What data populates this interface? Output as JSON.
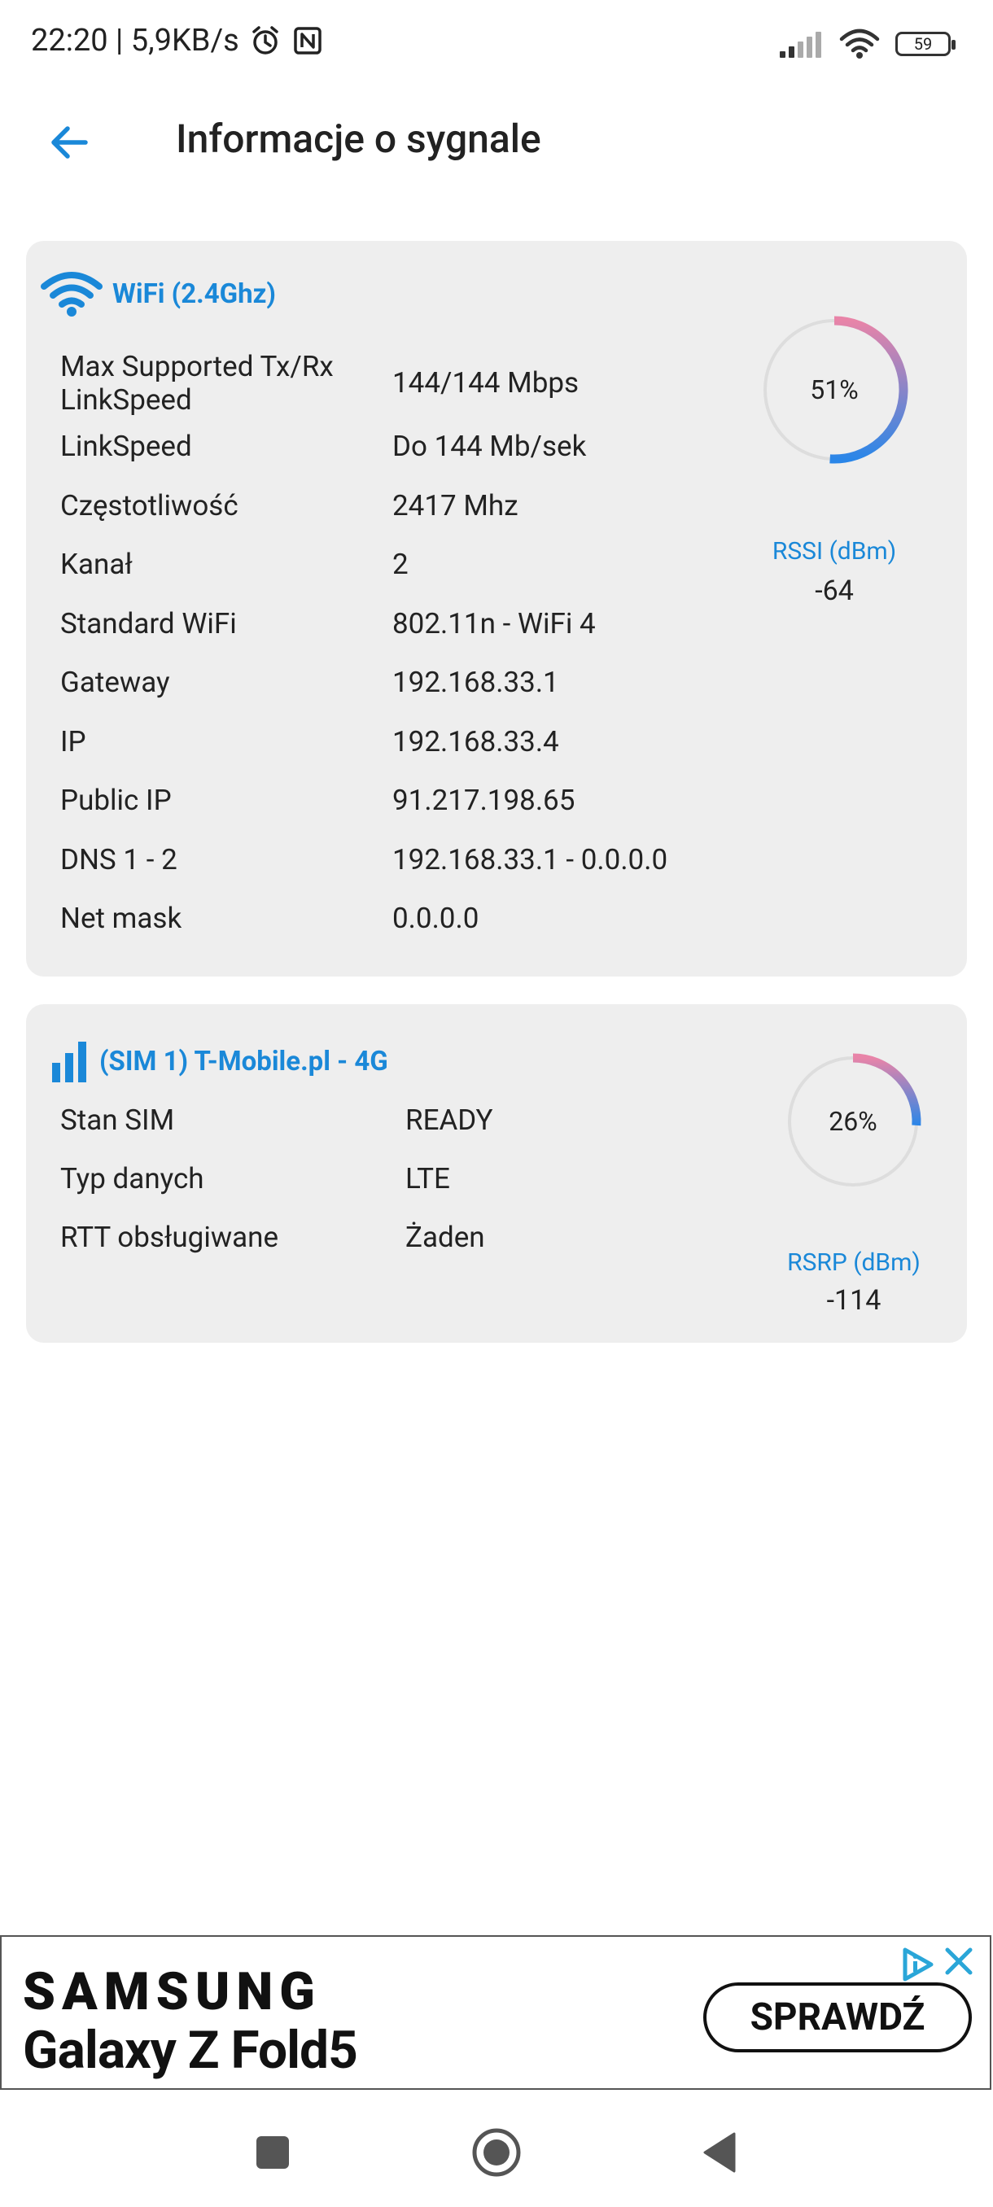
{
  "status_bar": {
    "time_speed": "22:20 | 5,9KB/s",
    "battery": "59",
    "icons": [
      "alarm-icon",
      "nfc-icon",
      "cell-signal-icon",
      "wifi-icon",
      "battery-icon"
    ]
  },
  "app_bar": {
    "title": "Informacje o sygnale",
    "back_icon": "arrow-left-icon"
  },
  "wifi_card": {
    "title": "WiFi (2.4Ghz)",
    "icon": "wifi-icon",
    "rows": [
      {
        "label": "Max Supported Tx/Rx\nLinkSpeed",
        "value": "144/144 Mbps"
      },
      {
        "label": "LinkSpeed",
        "value": "Do 144 Mb/sek"
      },
      {
        "label": "Częstotliwość",
        "value": "2417 Mhz"
      },
      {
        "label": "Kanał",
        "value": "2"
      },
      {
        "label": "Standard WiFi",
        "value": "802.11n - WiFi 4"
      },
      {
        "label": "Gateway",
        "value": "192.168.33.1"
      },
      {
        "label": "IP",
        "value": "192.168.33.4"
      },
      {
        "label": "Public IP",
        "value": "91.217.198.65"
      },
      {
        "label": "DNS 1 - 2",
        "value": "192.168.33.1 - 0.0.0.0"
      },
      {
        "label": "Net mask",
        "value": "0.0.0.0"
      }
    ],
    "gauge": {
      "percent_text": "51%",
      "percent": 51
    },
    "metric_label": "RSSI (dBm)",
    "metric_value": "-64"
  },
  "sim_card": {
    "title": "(SIM 1) T-Mobile.pl - 4G",
    "icon": "signal-bars-icon",
    "rows": [
      {
        "label": "Stan SIM",
        "value": "READY"
      },
      {
        "label": "Typ danych",
        "value": "LTE"
      },
      {
        "label": "RTT obsługiwane",
        "value": "Żaden"
      }
    ],
    "gauge": {
      "percent_text": "26%",
      "percent": 26
    },
    "metric_label": "RSRP (dBm)",
    "metric_value": "-114"
  },
  "ad": {
    "brand": "SAMSUNG",
    "product": "Galaxy Z Fold5",
    "cta": "SPRAWDŹ"
  },
  "nav_bar": {
    "icons": [
      "recents-square-icon",
      "home-circle-icon",
      "back-triangle-icon"
    ]
  },
  "colors": {
    "accent": "#1a88d8",
    "card_bg": "#eeeeee",
    "gauge_start": "#e884a8",
    "gauge_end": "#2a86e8"
  }
}
